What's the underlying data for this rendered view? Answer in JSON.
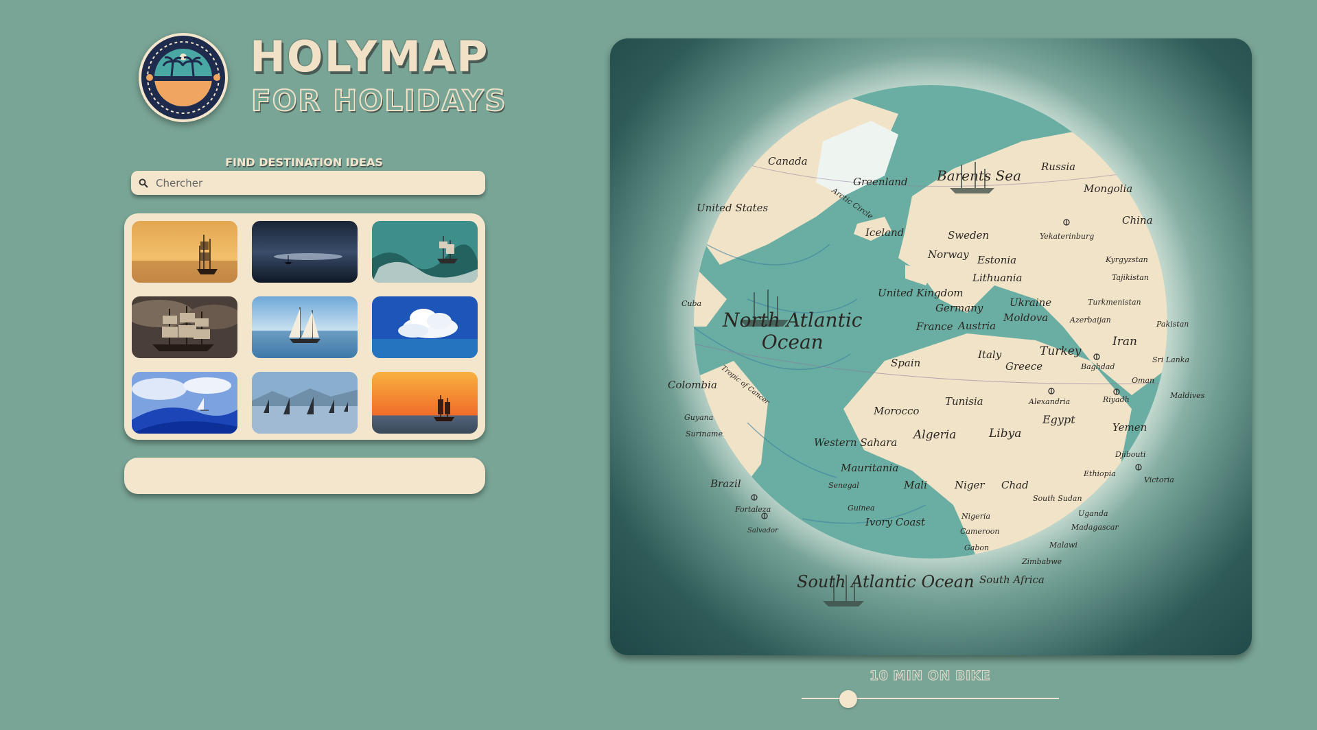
{
  "brand": {
    "title": "HOLYMAP",
    "subtitle": "FOR HOLIDAYS"
  },
  "search": {
    "heading": "FIND DESTINATION IDEAS",
    "placeholder": "Chercher",
    "icon": "search-icon"
  },
  "gallery": {
    "items": [
      {
        "name": "sunset-tall-ship"
      },
      {
        "name": "night-sea-boat"
      },
      {
        "name": "stormy-waves-ship"
      },
      {
        "name": "sailing-ship-clouds"
      },
      {
        "name": "schooner-calm-sea"
      },
      {
        "name": "cumulus-cloud-sea"
      },
      {
        "name": "blue-wave-sailboat"
      },
      {
        "name": "regatta-sailboats"
      },
      {
        "name": "orange-sunset-ship"
      }
    ]
  },
  "map": {
    "oceans": [
      "North Atlantic Ocean",
      "South Atlantic Ocean",
      "Barents Sea"
    ],
    "labels": [
      "Canada",
      "Greenland",
      "Russia",
      "Mongolia",
      "China",
      "United States",
      "Arctic Circle",
      "Iceland",
      "Sweden",
      "Yekaterinburg",
      "Norway",
      "Estonia",
      "Kyrgyzstan",
      "Lithuania",
      "Tajikistan",
      "United Kingdom",
      "Ukraine",
      "Turkmenistan",
      "Cuba",
      "Germany",
      "Moldova",
      "Azerbaijan",
      "Pakistan",
      "France",
      "Austria",
      "Iran",
      "Italy",
      "Turkey",
      "Spain",
      "Greece",
      "Baghdad",
      "Sri Lanka",
      "Colombia",
      "Tropic of Cancer",
      "Tunisia",
      "Alexandria",
      "Oman",
      "Maldives",
      "Riyadh",
      "Morocco",
      "Egypt",
      "Guyana",
      "Algeria",
      "Libya",
      "Yemen",
      "Suriname",
      "Western Sahara",
      "Djibouti",
      "Mauritania",
      "Ethiopia",
      "Victoria",
      "Brazil",
      "Senegal",
      "Mali",
      "Niger",
      "Chad",
      "South Sudan",
      "Fortaleza",
      "Guinea",
      "Uganda",
      "Nigeria",
      "Ivory Coast",
      "Madagascar",
      "Salvador",
      "Cameroon",
      "Gabon",
      "Malawi",
      "Zimbabwe",
      "South Africa"
    ]
  },
  "travel": {
    "label": "10 MIN ON BIKE",
    "slider_value": 0.18
  },
  "colors": {
    "background": "#79a596",
    "cream": "#f4e6cc",
    "navy": "#1e2b4d",
    "ocean": "#6aaea3",
    "land": "#f1e3c8"
  }
}
